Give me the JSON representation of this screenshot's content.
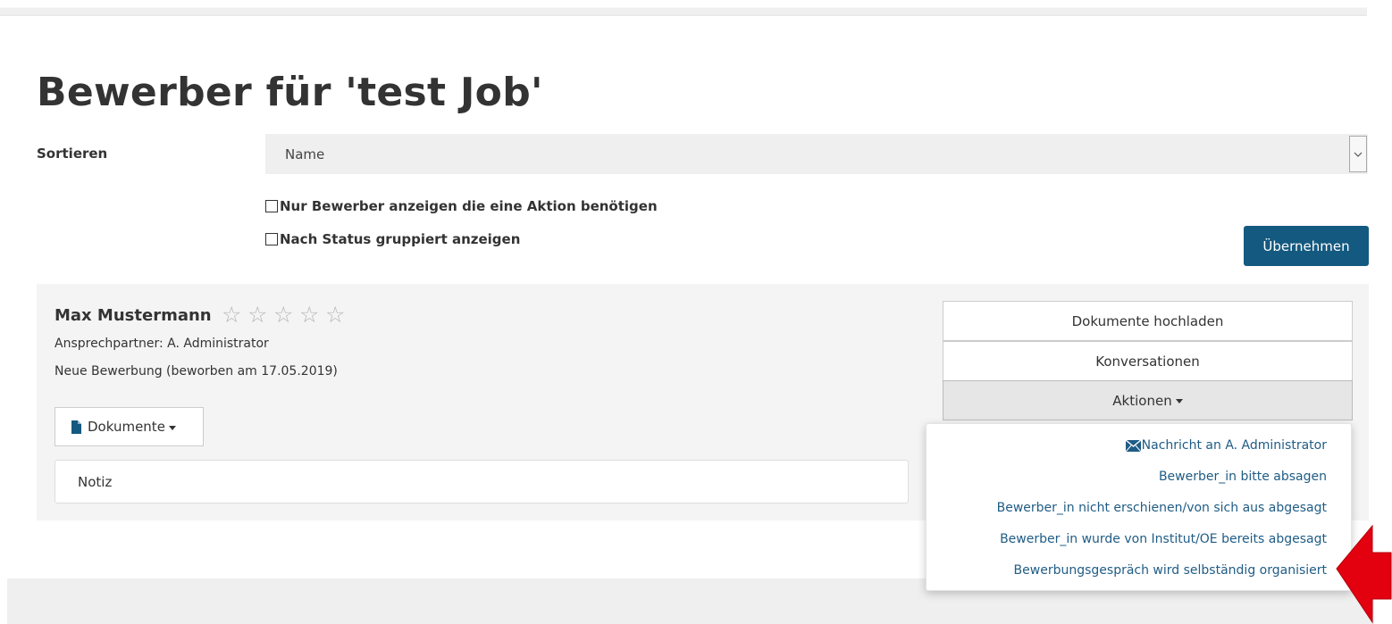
{
  "page": {
    "title": "Bewerber für 'test Job'"
  },
  "filters": {
    "sort_label": "Sortieren",
    "sort_value": "Name",
    "checkbox_action_label": "Nur Bewerber anzeigen die eine Aktion benötigen",
    "checkbox_action_checked": false,
    "checkbox_group_label": "Nach Status gruppiert anzeigen",
    "checkbox_group_checked": false,
    "apply_label": "Übernehmen"
  },
  "applicant": {
    "name": "Max Mustermann",
    "rating": 0,
    "rating_max": 5,
    "stars": [
      "☆",
      "☆",
      "☆",
      "☆",
      "☆"
    ],
    "contact": "Ansprechpartner: A. Administrator",
    "status": "Neue Bewerbung (beworben am 17.05.2019)",
    "documents_label": "Dokumente",
    "note_label": "Notiz"
  },
  "side_actions": {
    "upload_label": "Dokumente hochladen",
    "conversations_label": "Konversationen",
    "actions_label": "Aktionen"
  },
  "actions_menu": {
    "items": [
      {
        "label": "Nachricht an A. Administrator",
        "icon": "envelope-icon"
      },
      {
        "label": "Bewerber_in bitte absagen"
      },
      {
        "label": "Bewerber_in nicht erschienen/von sich aus abgesagt"
      },
      {
        "label": "Bewerber_in wurde von Institut/OE bereits abgesagt"
      },
      {
        "label": "Bewerbungsgespräch wird selbständig organisiert"
      }
    ]
  },
  "colors": {
    "primary": "#14597f",
    "link": "#1f5c85",
    "annotation_arrow": "#e3000f"
  }
}
